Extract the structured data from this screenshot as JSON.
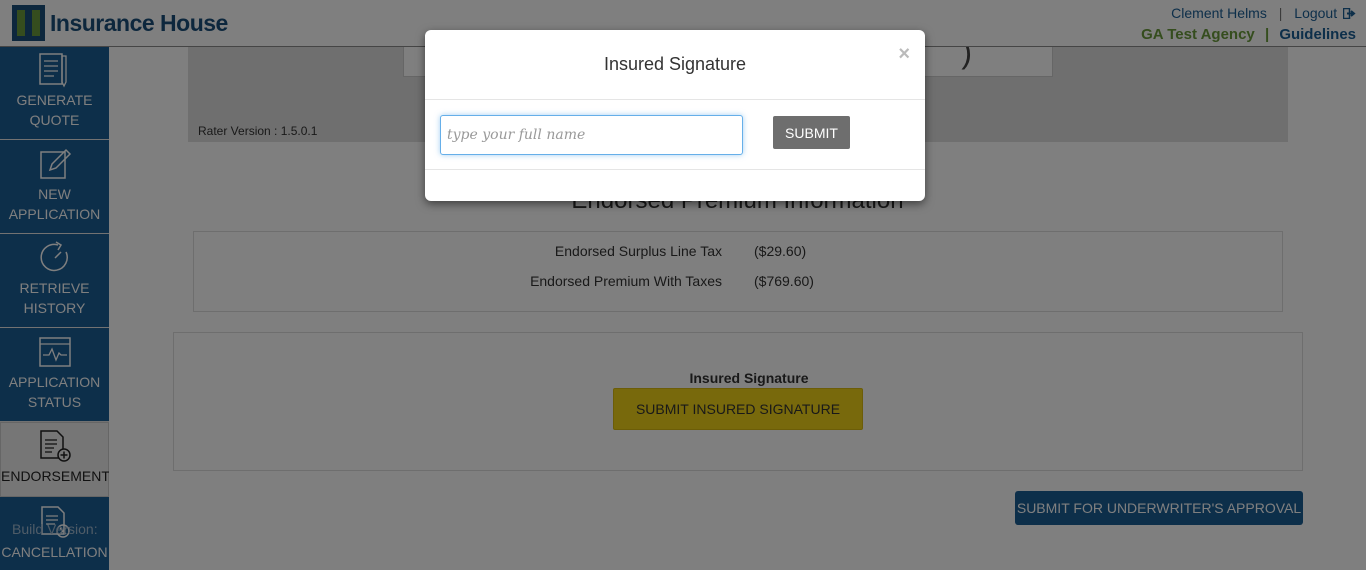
{
  "header": {
    "logo_text": "Insurance House",
    "user_name": "Clement Helms",
    "logout_label": "Logout",
    "agency_name": "GA Test Agency",
    "guidelines_label": "Guidelines",
    "separator": "|"
  },
  "sidebar": {
    "items": [
      {
        "label_line1": "GENERATE",
        "label_line2": "QUOTE",
        "icon": "generate-quote-icon"
      },
      {
        "label_line1": "NEW",
        "label_line2": "APPLICATION",
        "icon": "new-application-icon"
      },
      {
        "label_line1": "RETRIEVE",
        "label_line2": "HISTORY",
        "icon": "retrieve-history-icon"
      },
      {
        "label_line1": "APPLICATION",
        "label_line2": "STATUS",
        "icon": "application-status-icon"
      },
      {
        "label_line1": "ENDORSEMENT",
        "label_line2": "",
        "icon": "endorsement-icon"
      },
      {
        "label_line1": "CANCELLATION",
        "label_line2": "",
        "icon": "cancellation-icon"
      }
    ],
    "active_item": "ENDORSEMENT",
    "build_version": "Build Version:"
  },
  "main": {
    "rater_version": "Rater Version : 1.5.0.1",
    "partial_text": ")",
    "section_title": "Endorsed Premium Information",
    "premium_rows": [
      {
        "label": "Endorsed Surplus Line Tax",
        "value": "($29.60)"
      },
      {
        "label": "Endorsed Premium With Taxes",
        "value": "($769.60)"
      }
    ],
    "signature_label": "Insured Signature",
    "signature_button": "SUBMIT INSURED SIGNATURE",
    "approval_button": "SUBMIT FOR UNDERWRITER'S APPROVAL"
  },
  "modal": {
    "title": "Insured Signature",
    "close_symbol": "×",
    "input_placeholder": "type your full name",
    "input_value": "",
    "submit_label": "SUBMIT"
  },
  "colors": {
    "brand_blue": "#1b5e95",
    "brand_green": "#6a9a3c",
    "signature_yellow": "#f1d318",
    "submit_gray": "#6e6e6e"
  }
}
